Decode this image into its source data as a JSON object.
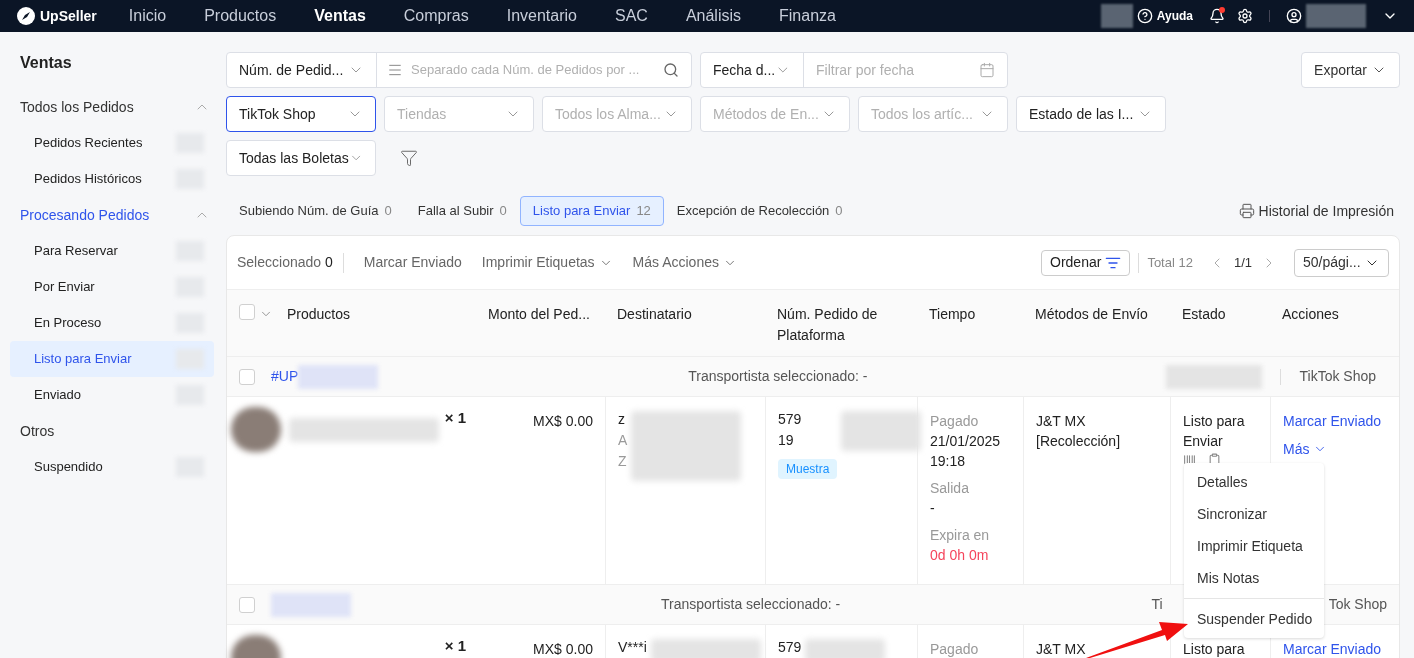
{
  "nav": {
    "logo": "UpSeller",
    "items": [
      {
        "label": "Inicio",
        "selected": false
      },
      {
        "label": "Productos",
        "selected": false
      },
      {
        "label": "Ventas",
        "selected": true
      },
      {
        "label": "Compras",
        "selected": false
      },
      {
        "label": "Inventario",
        "selected": false
      },
      {
        "label": "SAC",
        "selected": false
      },
      {
        "label": "Análisis",
        "selected": false
      },
      {
        "label": "Finanza",
        "selected": false
      }
    ],
    "help": "Ayuda"
  },
  "sidebar": {
    "title": "Ventas",
    "groups": [
      {
        "label": "Todos los Pedidos",
        "expanded": true,
        "selected": false,
        "children": [
          {
            "label": "Pedidos Recientes",
            "selected": false
          },
          {
            "label": "Pedidos Históricos",
            "selected": false
          }
        ]
      },
      {
        "label": "Procesando Pedidos",
        "expanded": true,
        "selected": true,
        "children": [
          {
            "label": "Para Reservar",
            "selected": false
          },
          {
            "label": "Por Enviar",
            "selected": false
          },
          {
            "label": "En Proceso",
            "selected": false
          },
          {
            "label": "Listo para Enviar",
            "selected": true
          },
          {
            "label": "Enviado",
            "selected": false
          }
        ]
      },
      {
        "label": "Otros",
        "selected": false,
        "children": [
          {
            "label": "Suspendido",
            "selected": false
          }
        ]
      }
    ]
  },
  "filters": {
    "search": {
      "field": "Núm. de Pedid...",
      "placeholder": "Separado cada Núm. de Pedidos por ..."
    },
    "date": {
      "field": "Fecha d...",
      "placeholder": "Filtrar por fecha"
    },
    "export": "Exportar",
    "selects": [
      [
        {
          "value": "TikTok Shop",
          "focused": true
        },
        {
          "placeholder": "Tiendas",
          "focused": false
        },
        {
          "placeholder": "Todos los Alma...",
          "focused": false
        },
        {
          "placeholder": "Métodos de En...",
          "focused": false
        },
        {
          "placeholder": "Todos los artíc...",
          "focused": false
        },
        {
          "value": "Estado de las I...",
          "focused": false
        }
      ],
      [
        {
          "value": "Todas las Boletas",
          "focused": false
        }
      ]
    ]
  },
  "status_tabs": [
    {
      "label": "Subiendo Núm. de Guía",
      "count": "0",
      "selected": false
    },
    {
      "label": "Falla al Subir",
      "count": "0",
      "selected": false
    },
    {
      "label": "Listo para Enviar",
      "count": "12",
      "selected": true
    },
    {
      "label": "Excepción de Recolección",
      "count": "0",
      "selected": false
    }
  ],
  "print_history": "Historial de Impresión",
  "toolbar": {
    "selected_label": "Seleccionado",
    "selected_count": "0",
    "actions": [
      {
        "label": "Marcar Enviado",
        "dropdown": false
      },
      {
        "label": "Imprimir Etiquetas",
        "dropdown": true
      },
      {
        "label": "Más Acciones",
        "dropdown": true
      }
    ],
    "sort": "Ordenar",
    "total": "Total 12",
    "page": "1/1",
    "page_size": "50/pági..."
  },
  "table": {
    "checked": false,
    "columns": [
      "Productos",
      "Monto del Ped...",
      "Destinatario",
      "Núm. Pedido de Plataforma",
      "Tiempo",
      "Métodos de Envío",
      "Estado",
      "Acciones"
    ]
  },
  "orders": [
    {
      "checked": false,
      "order_id": "#UP",
      "carrier": "Transportista seleccionado: -",
      "platform": [
        "TikTok Shop"
      ],
      "qty": "× 1",
      "amount": "MX$ 0.00",
      "recipient": [
        "z",
        "A",
        "Z"
      ],
      "platform_order": [
        "579",
        "19"
      ],
      "tag": "Muestra",
      "time": [
        {
          "label": "Pagado",
          "value": "21/01/2025 19:18",
          "urgent": false
        },
        {
          "label": "Salida",
          "value": "-",
          "urgent": false
        },
        {
          "label": "Expira en",
          "value": "0d 0h 0m",
          "urgent": true
        }
      ],
      "shipping": "J&T MX [Recolección]",
      "status": "Listo para Enviar",
      "actions": [
        "Marcar Enviado",
        "Más"
      ]
    },
    {
      "checked": false,
      "carrier": "Transportista seleccionado: -",
      "platform": [
        "Ti",
        "Tok Shop"
      ],
      "qty": "× 1",
      "amount": "MX$ 0.00",
      "recipient": [
        "V***i"
      ],
      "platform_order": [
        "579"
      ],
      "time": [
        {
          "label": "Pagado"
        }
      ],
      "shipping": "J&T MX",
      "status": "Listo para",
      "actions": [
        "Marcar Enviado"
      ]
    }
  ],
  "menu": {
    "items": [
      {
        "label": "Detalles",
        "divider_before": false
      },
      {
        "label": "Sincronizar",
        "divider_before": false
      },
      {
        "label": "Imprimir Etiqueta",
        "divider_before": false
      },
      {
        "label": "Mis Notas",
        "divider_before": false
      },
      {
        "label": "Suspender Pedido",
        "divider_before": true
      }
    ]
  }
}
